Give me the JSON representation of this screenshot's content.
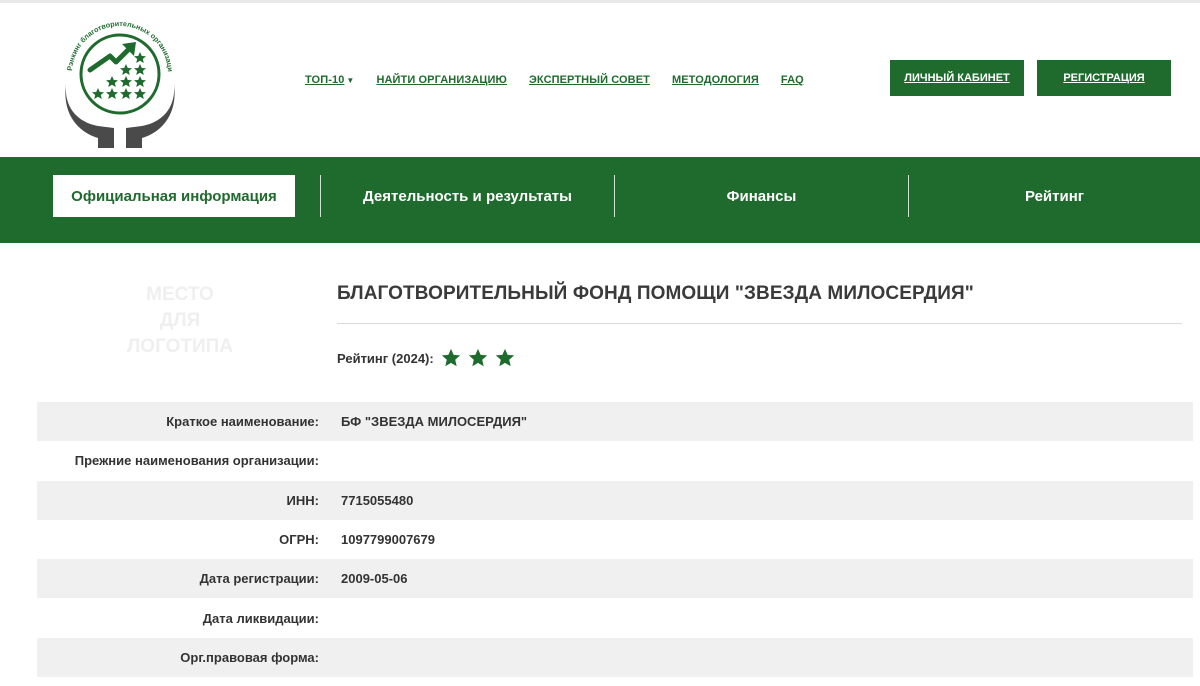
{
  "logo": {
    "ring_text": "Рэнкинг благотворительных организаций РФ"
  },
  "header": {
    "nav": [
      {
        "label": "ТОП-10",
        "has_dropdown": true
      },
      {
        "label": "НАЙТИ ОРГАНИЗАЦИЮ"
      },
      {
        "label": "ЭКСПЕРТНЫЙ СОВЕТ"
      },
      {
        "label": "МЕТОДОЛОГИЯ"
      },
      {
        "label": "FAQ"
      }
    ],
    "cabinet_label": "ЛИЧНЫЙ КАБИНЕТ",
    "register_label": "РЕГИСТРАЦИЯ"
  },
  "tabs": [
    {
      "label": "Официальная информация",
      "active": true
    },
    {
      "label": "Деятельность и результаты",
      "active": false
    },
    {
      "label": "Финансы",
      "active": false
    },
    {
      "label": "Рейтинг",
      "active": false
    }
  ],
  "organization": {
    "logo_placeholder": [
      "МЕСТО",
      "ДЛЯ",
      "ЛОГОТИПА"
    ],
    "title": "БЛАГОТВОРИТЕЛЬНЫЙ ФОНД ПОМОЩИ \"ЗВЕЗДА МИЛОСЕРДИЯ\"",
    "rating_label": "Рейтинг (2024):",
    "rating_stars": 3
  },
  "info": [
    {
      "label": "Краткое наименование:",
      "value": "БФ \"ЗВЕЗДА МИЛОСЕРДИЯ\""
    },
    {
      "label": "Прежние наименования организации:",
      "value": ""
    },
    {
      "label": "ИНН:",
      "value": "7715055480"
    },
    {
      "label": "ОГРН:",
      "value": "1097799007679"
    },
    {
      "label": "Дата регистрации:",
      "value": "2009-05-06"
    },
    {
      "label": "Дата ликвидации:",
      "value": ""
    },
    {
      "label": "Орг.правовая форма:",
      "value": ""
    }
  ],
  "colors": {
    "brand_green": "#1f6b2e",
    "hands_gray": "#4a4a4a",
    "row_stripe": "#f0f0f0"
  }
}
